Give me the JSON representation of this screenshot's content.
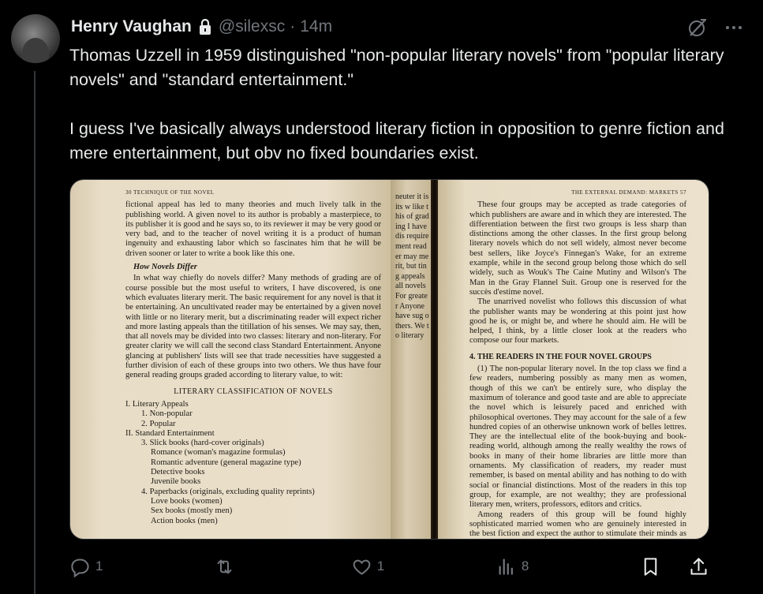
{
  "author": {
    "name": "Henry Vaughan",
    "handle": "@silexsc",
    "separator": "·",
    "time": "14m",
    "protected_icon": "lock-icon"
  },
  "tweet": {
    "text": "Thomas Uzzell in 1959 distinguished \"non-popular literary novels\" from \"popular literary novels\" and \"standard entertainment.\"\n\nI guess I've basically always understood literary fiction in opposition to genre fiction and mere entertainment, but obv no fixed boundaries exist."
  },
  "header_icons": [
    "grok-icon",
    "more-icon"
  ],
  "media": {
    "left_page": {
      "running_head": "30   TECHNIQUE OF THE NOVEL",
      "para1": "fictional appeal has led to many theories and much lively talk in the publishing world. A given novel to its author is probably a masterpiece, to its publisher it is good and he says so, to its reviewer it may be very good or very bad, and to the teacher of novel writing it is a product of human ingenuity and exhausting labor which so fascinates him that he will be driven sooner or later to write a book like this one.",
      "heading": "How Novels Differ",
      "para2": "In what way chiefly do novels differ? Many methods of grading are of course possible but the most useful to writers, I have discovered, is one which evaluates literary merit. The basic requirement for any novel is that it be entertaining. An uncultivated reader may be entertained by a given novel with little or no literary merit, but a discriminating reader will expect richer and more lasting appeals than the titillation of his senses. We may say, then, that all novels may be divided into two classes: literary and non-literary. For greater clarity we will call the second class Standard Entertainment. Anyone glancing at publishers' lists will see that trade necessities have suggested a further division of each of these groups into two others. We thus have four general reading groups graded according to literary value, to wit:",
      "class_title": "LITERARY CLASSIFICATION OF NOVELS",
      "classification": [
        {
          "level": 1,
          "text": "I. Literary Appeals"
        },
        {
          "level": 2,
          "text": "1. Non-popular"
        },
        {
          "level": 2,
          "text": "2. Popular"
        },
        {
          "level": 1,
          "text": "II. Standard Entertainment"
        },
        {
          "level": 2,
          "text": "3. Slick books (hard-cover originals)"
        },
        {
          "level": 3,
          "text": "Romance (woman's magazine formulas)"
        },
        {
          "level": 3,
          "text": "Romantic adventure (general magazine type)"
        },
        {
          "level": 3,
          "text": "Detective books"
        },
        {
          "level": 3,
          "text": "Juvenile books"
        },
        {
          "level": 2,
          "text": "4. Paperbacks (originals, excluding quality reprints)"
        },
        {
          "level": 3,
          "text": "Love books (women)"
        },
        {
          "level": 3,
          "text": "Sex books (mostly men)"
        },
        {
          "level": 3,
          "text": "Action books (men)"
        }
      ]
    },
    "middle_strip": "neuter it is its w like this of grading I have dis requirement reader may merit, but ting appeals all novels For greater Anyone have sug others. We to literary",
    "right_page": {
      "running_head": "THE EXTERNAL DEMAND: MARKETS   57",
      "para1": "These four groups may be accepted as trade categories of which publishers are aware and in which they are interested. The differentiation between the first two groups is less sharp than distinctions among the other classes. In the first group belong literary novels which do not sell widely, almost never become best sellers, like Joyce's Finnegan's Wake, for an extreme example, while in the second group belong those which do sell widely, such as Wouk's The Caine Mutiny and Wilson's The Man in the Gray Flannel Suit. Group one is reserved for the succès d'estime novel.",
      "para2": "The unarrived novelist who follows this discussion of what the publisher wants may be wondering at this point just how good he is, or might be, and where he should aim. He will be helped, I think, by a little closer look at the readers who compose our four markets.",
      "heading": "4. THE READERS IN THE FOUR NOVEL GROUPS",
      "para3": "(1) The non-popular literary novel. In the top class we find a few readers, numbering possibly as many men as women, though of this we can't be entirely sure, who display the maximum of tolerance and good taste and are able to appreciate the novel which is leisurely paced and enriched with philosophical overtones. They may account for the sale of a few hundred copies of an otherwise unknown work of belles lettres. They are the intellectual elite of the book-buying and book-reading world, although among the really wealthy the rows of books in many of their home libraries are little more than ornaments. My classification of readers, my reader must remember, is based on mental ability and has nothing to do with social or financial distinctions. Most of the readers in this top group, for example, are not wealthy; they are professional literary men, writers, professors, editors and critics.",
      "para4": "Among readers of this group will be found highly sophisticated married women who are genuinely interested in the best fiction and expect the author to stimulate their minds as well as their senses. With them we must mention scattered intellectuals with liberal or radical social beliefs who revel in criticisms and actions with which they sympathize. These people with superior minds whom I am now"
    }
  },
  "actions": {
    "reply": {
      "icon": "reply-icon",
      "count": "1"
    },
    "repost": {
      "icon": "repost-icon",
      "count": ""
    },
    "like": {
      "icon": "heart-icon",
      "count": "1"
    },
    "views": {
      "icon": "views-icon",
      "count": "8"
    },
    "bookmark": {
      "icon": "bookmark-icon"
    },
    "share": {
      "icon": "share-icon"
    }
  }
}
